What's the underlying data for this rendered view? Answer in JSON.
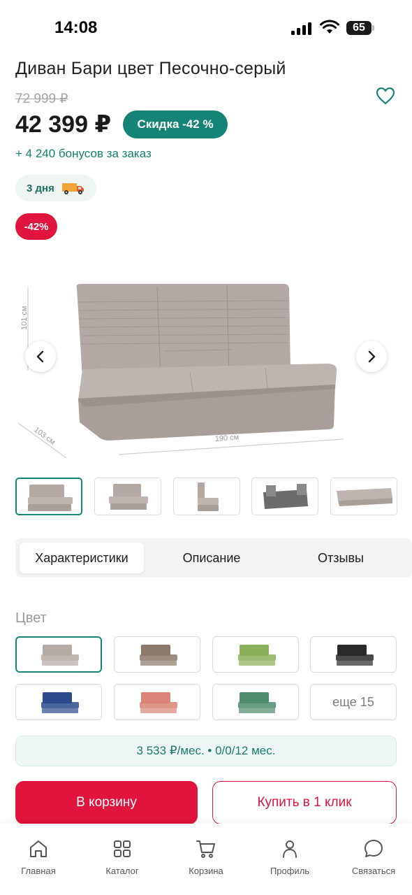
{
  "status_bar": {
    "time": "14:08",
    "battery": "65",
    "icons": [
      "signal-icon",
      "wifi-icon",
      "battery-icon"
    ]
  },
  "product": {
    "title": "Диван Бари цвет Песочно-серый",
    "old_price": "72 999 ₽",
    "price": "42 399 ₽",
    "discount_label": "Скидка -42 %",
    "bonus": "+ 4 240 бонусов за заказ",
    "delivery": "3 дня",
    "badge": "-42%"
  },
  "gallery": {
    "dimensions": {
      "height": "101 см",
      "depth": "103 см",
      "width": "190 см"
    },
    "thumbnail_count": 5,
    "active_thumbnail": 1
  },
  "tabs": [
    {
      "label": "Характеристики",
      "active": true
    },
    {
      "label": "Описание",
      "active": false
    },
    {
      "label": "Отзывы",
      "active": false
    }
  ],
  "colors": {
    "label": "Цвет",
    "swatches": [
      "#b5aaa5",
      "#8c7a6b",
      "#8bb05a",
      "#2a2a2a",
      "#2c4a8c",
      "#d98476",
      "#4f8c6e"
    ],
    "more_label": "еще 15"
  },
  "installment": "3 533 ₽/мес. • 0/0/12 мес.",
  "actions": {
    "add_to_cart": "В корзину",
    "buy_one_click": "Купить в 1 клик"
  },
  "nav": [
    {
      "label": "Главная",
      "icon": "home-icon"
    },
    {
      "label": "Каталог",
      "icon": "catalog-icon"
    },
    {
      "label": "Корзина",
      "icon": "cart-icon"
    },
    {
      "label": "Профиль",
      "icon": "profile-icon"
    },
    {
      "label": "Связаться",
      "icon": "chat-icon"
    }
  ],
  "colors_theme": {
    "accent_green": "#158477",
    "accent_red": "#e0143c"
  }
}
